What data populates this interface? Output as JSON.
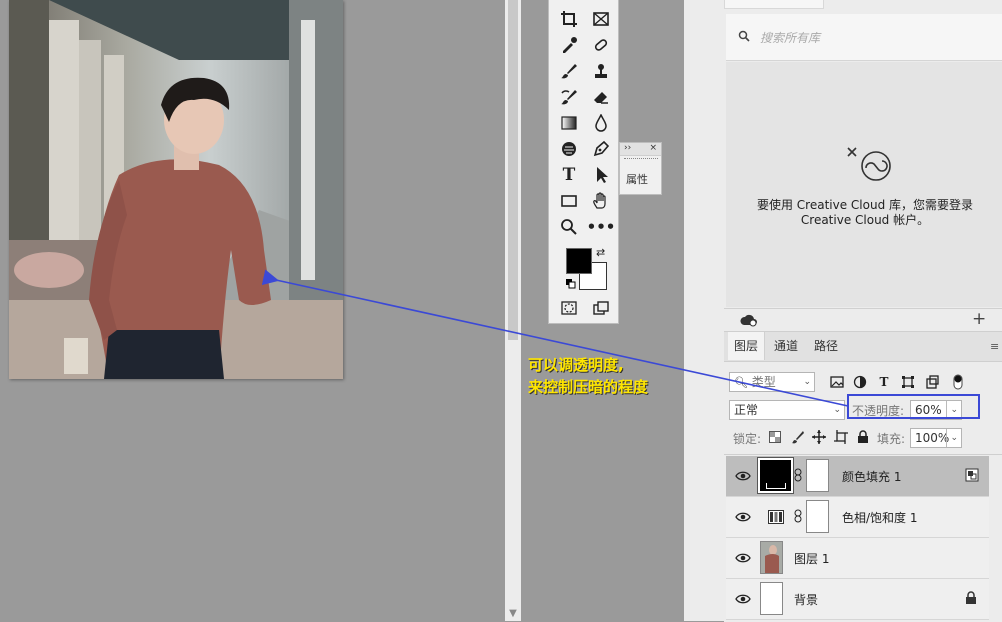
{
  "library": {
    "search_placeholder": "搜索所有库",
    "message": "要使用 Creative Cloud 库，您需要登录 Creative Cloud 帐户。"
  },
  "properties": {
    "label": "属性"
  },
  "layers_panel": {
    "tabs": [
      "图层",
      "通道",
      "路径"
    ],
    "filter_type": "类型",
    "blend_mode": "正常",
    "opacity_label": "不透明度:",
    "opacity_value": "60%",
    "lock_label": "锁定:",
    "fill_label": "填充:",
    "fill_value": "100%",
    "layers": [
      {
        "name": "颜色填充 1",
        "selected": true
      },
      {
        "name": "色相/饱和度 1",
        "selected": false
      },
      {
        "name": "图层 1",
        "selected": false
      },
      {
        "name": "背景",
        "selected": false
      }
    ]
  },
  "annotation": {
    "text": "可以调透明度,\n来控制压暗的程度",
    "color": "#ffe600"
  },
  "colors": {
    "highlight_box": "#3b49d6",
    "arrow": "#3b49d6",
    "foreground": "#000000",
    "background": "#ffffff"
  }
}
